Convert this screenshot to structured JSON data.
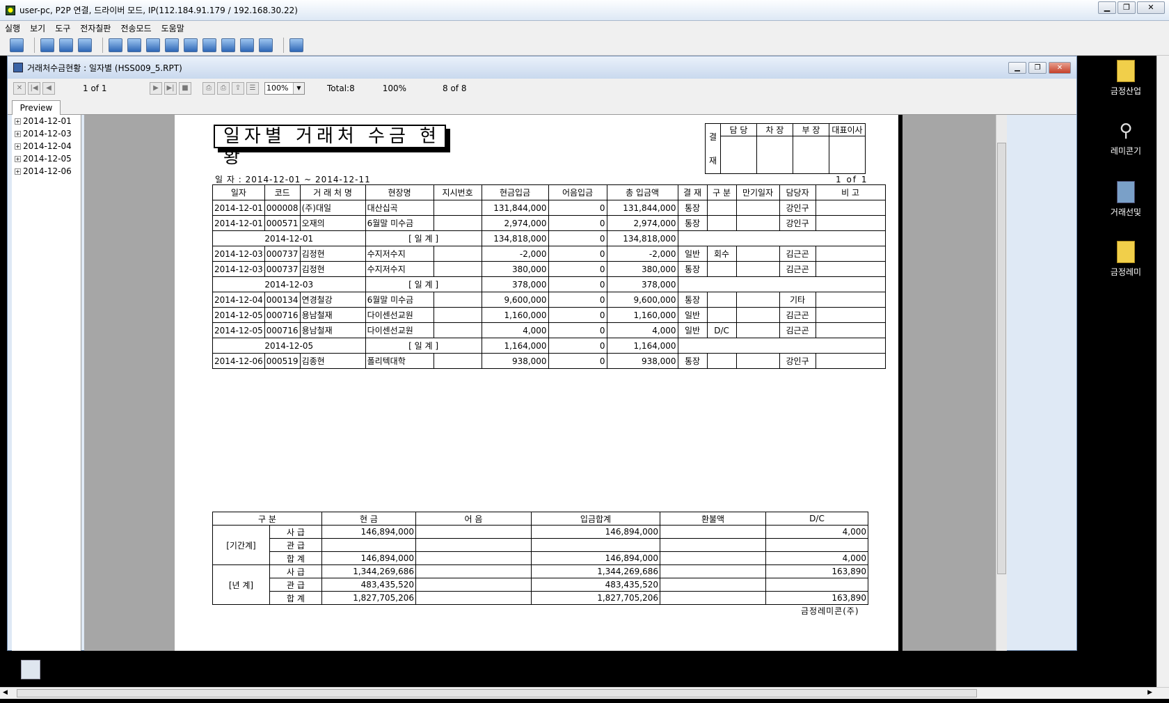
{
  "outer_window": {
    "title": "user-pc, P2P 연결, 드라이버 모드, IP(112.184.91.179 / 192.168.30.22)"
  },
  "menu": [
    "실행",
    "보기",
    "도구",
    "전자칠판",
    "전송모드",
    "도움말"
  ],
  "desktop_icons": [
    "금정산업",
    "레미콘기",
    "거래선및",
    "금정레미"
  ],
  "report_window": {
    "title": "거래처수금현황 : 일자별 (HSS009_5.RPT)",
    "page_nav": "1 of 1",
    "zoom": "100%",
    "total": "Total:8",
    "percent": "100%",
    "records": "8 of 8",
    "tab": "Preview"
  },
  "tree_nodes": [
    "2014-12-01",
    "2014-12-03",
    "2014-12-04",
    "2014-12-05",
    "2014-12-06"
  ],
  "report": {
    "title": "일자별 거래처 수금 현황",
    "approval": {
      "label1": "결",
      "label2": "재",
      "cols": [
        "담 당",
        "차 장",
        "부 장",
        "대표이사"
      ]
    },
    "period": "일 자 : 2014-12-01 ~   2014-12-11",
    "page": "1 of 1",
    "columns": [
      "일자",
      "코드",
      "거 래 처 명",
      "현장명",
      "지시번호",
      "현금입금",
      "어음입금",
      "총 입금액",
      "결 재",
      "구 분",
      "만기일자",
      "담당자",
      "비 고"
    ],
    "rows": [
      {
        "type": "row",
        "cells": [
          "2014-12-01",
          "000008",
          "(주)대일",
          "대산십곡",
          "",
          "131,844,000",
          "0",
          "131,844,000",
          "통장",
          "",
          "",
          "강인구",
          ""
        ]
      },
      {
        "type": "row",
        "cells": [
          "2014-12-01",
          "000571",
          "오재의",
          "6월말 미수금",
          "",
          "2,974,000",
          "0",
          "2,974,000",
          "통장",
          "",
          "",
          "강인구",
          ""
        ]
      },
      {
        "type": "sub",
        "date": "2014-12-01",
        "label": "[ 일   계 ]",
        "cash": "134,818,000",
        "note": "0",
        "total": "134,818,000"
      },
      {
        "type": "row",
        "cells": [
          "2014-12-03",
          "000737",
          "김정현",
          "수지저수지",
          "",
          "-2,000",
          "0",
          "-2,000",
          "일반",
          "회수",
          "",
          "김근곤",
          ""
        ]
      },
      {
        "type": "row",
        "cells": [
          "2014-12-03",
          "000737",
          "김정현",
          "수지저수지",
          "",
          "380,000",
          "0",
          "380,000",
          "통장",
          "",
          "",
          "김근곤",
          ""
        ]
      },
      {
        "type": "sub",
        "date": "2014-12-03",
        "label": "[ 일   계 ]",
        "cash": "378,000",
        "note": "0",
        "total": "378,000"
      },
      {
        "type": "row",
        "cells": [
          "2014-12-04",
          "000134",
          "연경철강",
          "6월말 미수금",
          "",
          "9,600,000",
          "0",
          "9,600,000",
          "통장",
          "",
          "",
          "기타",
          ""
        ]
      },
      {
        "type": "row",
        "cells": [
          "2014-12-05",
          "000716",
          "용남철재",
          "다이센선교원",
          "",
          "1,160,000",
          "0",
          "1,160,000",
          "일반",
          "",
          "",
          "김근곤",
          ""
        ]
      },
      {
        "type": "row",
        "cells": [
          "2014-12-05",
          "000716",
          "용남철재",
          "다이센선교원",
          "",
          "4,000",
          "0",
          "4,000",
          "일반",
          "D/C",
          "",
          "김근곤",
          ""
        ]
      },
      {
        "type": "sub",
        "date": "2014-12-05",
        "label": "[ 일   계 ]",
        "cash": "1,164,000",
        "note": "0",
        "total": "1,164,000"
      },
      {
        "type": "row",
        "cells": [
          "2014-12-06",
          "000519",
          "김종현",
          "폴리텍대학",
          "",
          "938,000",
          "0",
          "938,000",
          "통장",
          "",
          "",
          "강인구",
          ""
        ]
      }
    ],
    "summary": {
      "headers": [
        "구 분",
        "현 금",
        "어 음",
        "입금합계",
        "환불액",
        "D/C"
      ],
      "groups": [
        {
          "label": "[기간계]",
          "rows": [
            {
              "sub": "사   급",
              "cash": "146,894,000",
              "note": "",
              "sum": "146,894,000",
              "refund": "",
              "dc": "4,000"
            },
            {
              "sub": "관   급",
              "cash": "",
              "note": "",
              "sum": "",
              "refund": "",
              "dc": ""
            },
            {
              "sub": "합   계",
              "cash": "146,894,000",
              "note": "",
              "sum": "146,894,000",
              "refund": "",
              "dc": "4,000"
            }
          ]
        },
        {
          "label": "[년   계]",
          "rows": [
            {
              "sub": "사   급",
              "cash": "1,344,269,686",
              "note": "",
              "sum": "1,344,269,686",
              "refund": "",
              "dc": "163,890"
            },
            {
              "sub": "관   급",
              "cash": "483,435,520",
              "note": "",
              "sum": "483,435,520",
              "refund": "",
              "dc": ""
            },
            {
              "sub": "합   계",
              "cash": "1,827,705,206",
              "note": "",
              "sum": "1,827,705,206",
              "refund": "",
              "dc": "163,890"
            }
          ]
        }
      ]
    },
    "company": "금정레미콘(주)"
  }
}
